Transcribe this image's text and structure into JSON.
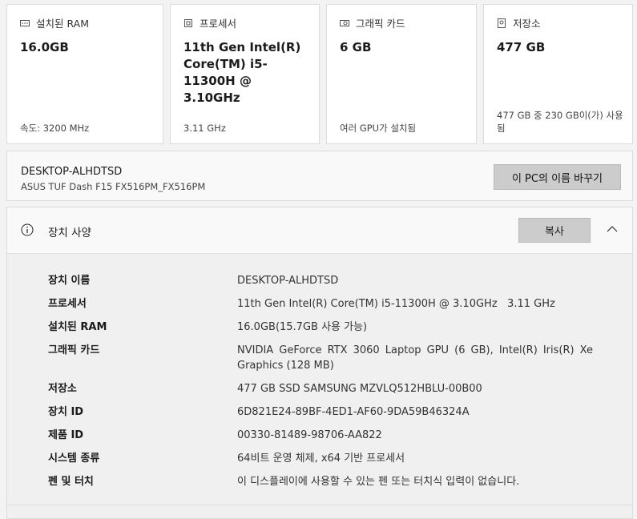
{
  "cards": [
    {
      "label": "설치된 RAM",
      "value": "16.0GB",
      "sub": "속도: 3200 MHz",
      "icon": "ram-icon"
    },
    {
      "label": "프로세서",
      "value": "11th Gen Intel(R) Core(TM) i5-11300H @ 3.10GHz",
      "sub": "3.11 GHz",
      "icon": "processor-icon"
    },
    {
      "label": "그래픽 카드",
      "value": "6 GB",
      "sub": "여러 GPU가 설치됨",
      "icon": "graphics-card-icon"
    },
    {
      "label": "저장소",
      "value": "477 GB",
      "sub": "477 GB 중 230 GB이(가) 사용됨",
      "icon": "storage-icon"
    }
  ],
  "pc": {
    "name": "DESKTOP-ALHDTSD",
    "model": "ASUS TUF Dash F15 FX516PM_FX516PM",
    "rename_label": "이 PC의 이름 바꾸기"
  },
  "specs": {
    "title": "장치 사양",
    "copy_label": "복사",
    "rows": [
      {
        "k": "장치 이름",
        "v": "DESKTOP-ALHDTSD"
      },
      {
        "k": "프로세서",
        "v": "11th Gen Intel(R) Core(TM) i5-11300H @ 3.10GHz   3.11 GHz"
      },
      {
        "k": "설치된 RAM",
        "v": "16.0GB(15.7GB 사용 가능)"
      },
      {
        "k": "그래픽 카드",
        "v": "NVIDIA GeForce RTX 3060 Laptop GPU (6 GB), Intel(R) Iris(R) Xe Graphics (128 MB)"
      },
      {
        "k": "저장소",
        "v": "477 GB SSD SAMSUNG MZVLQ512HBLU-00B00"
      },
      {
        "k": "장치 ID",
        "v": "6D821E24-89BF-4ED1-AF60-9DA59B46324A"
      },
      {
        "k": "제품 ID",
        "v": "00330-81489-98706-AA822"
      },
      {
        "k": "시스템 종류",
        "v": "64비트 운영 체제, x64 기반 프로세서"
      },
      {
        "k": "펜 및 터치",
        "v": "이 디스플레이에 사용할 수 있는 펜 또는 터치식 입력이 없습니다."
      }
    ]
  }
}
